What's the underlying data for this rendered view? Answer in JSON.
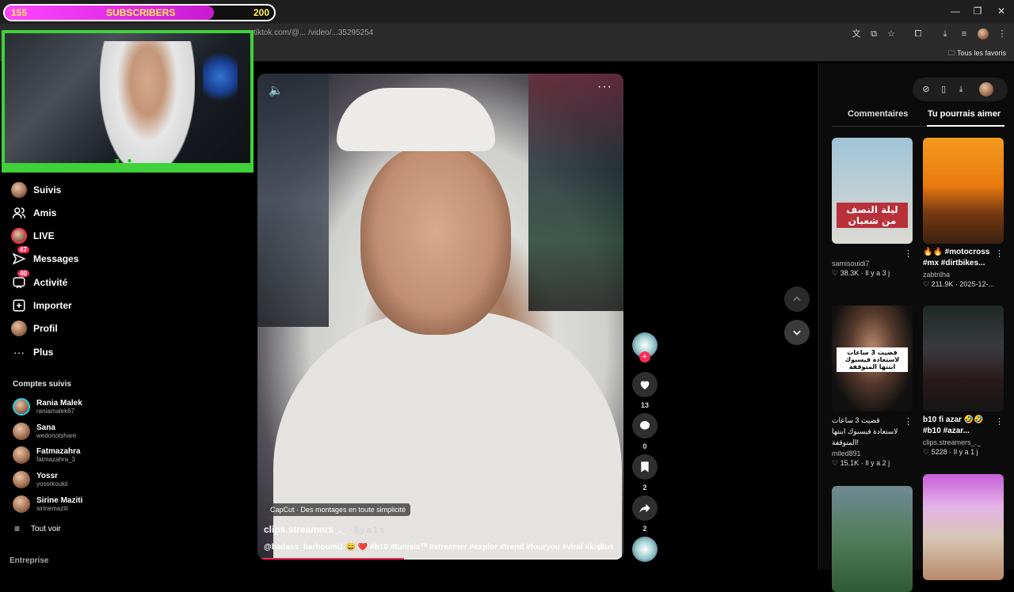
{
  "overlay": {
    "subs_current": "155",
    "subs_label": "SUBSCRIBERS",
    "subs_goal": "200",
    "subs_progress": 0.775,
    "webcam_logo": "bio"
  },
  "browser": {
    "url": "tiktok.com/@... /video/...35295254",
    "bookmarks_label": "Tous les favoris",
    "window_minimize": "—",
    "window_restore": "❐",
    "window_close": "✕"
  },
  "sidebar": {
    "items": [
      {
        "label": "Suivis",
        "icon": "following-avatar-icon"
      },
      {
        "label": "Amis",
        "icon": "friends-icon"
      },
      {
        "label": "LIVE",
        "icon": "live-icon"
      },
      {
        "label": "Messages",
        "icon": "messages-icon",
        "badge": "47"
      },
      {
        "label": "Activité",
        "icon": "activity-icon",
        "badge": "40"
      },
      {
        "label": "Importer",
        "icon": "upload-icon"
      },
      {
        "label": "Profil",
        "icon": "profile-icon"
      },
      {
        "label": "Plus",
        "icon": "more-icon"
      }
    ],
    "following_title": "Comptes suivis",
    "accounts": [
      {
        "name": "Rania Malek",
        "handle": "raniamalek67"
      },
      {
        "name": "Sana",
        "handle": "wedonotshare"
      },
      {
        "name": "Fatmazahra",
        "handle": "fatmazahra_3"
      },
      {
        "name": "Yossr",
        "handle": "yossrkoukii"
      },
      {
        "name": "Sirine Maziti",
        "handle": "sirinemaziti"
      }
    ],
    "see_all": "Tout voir",
    "footer": "Entreprise"
  },
  "video": {
    "capcut": "CapCut · Des montages en toute simplicité",
    "author": "clips.streamers_._",
    "time": "· Il y a 1 s",
    "caption": "@badass_barhoumi1 😄 ❤️ #b10 #tunisiaᵀᴺ #streamer #explor #trend #fouryou #viral #kick ...",
    "more": "plus",
    "progress": 0.4
  },
  "actions": {
    "likes": "13",
    "comments": "0",
    "saves": "2",
    "shares": "2"
  },
  "right_panel": {
    "tabs": [
      "Commentaires",
      "Tu pourrais aimer"
    ],
    "active_tab": "Tu pourrais aimer",
    "cards": [
      {
        "thumb_text": "ليلة النصف من شعبان",
        "title": "",
        "user": "samisouidi7",
        "meta": "♡ 38.3K · Il y a 3 j"
      },
      {
        "thumb_text": "",
        "title": "🔥🔥 #motocross #mx #dirtbikes...",
        "user": "zabtrilha",
        "meta": "♡ 211.9K · 2025-12-..."
      },
      {
        "thumb_text": "قضيت 3 ساعات لاستعادة فيسبوك ابنتها المتوقفة",
        "title": "قضيت 3 ساعات لاستعادة فيسبوك ابنتها المتوقفة!",
        "user": "miled891",
        "meta": "♡ 15.1K · Il y a 2 j"
      },
      {
        "thumb_text": "",
        "title": "b10 fi azar 🤣🤣 #b10 #azar...",
        "user": "clips.streamers_._",
        "meta": "♡ 5228 · Il y a 1 j"
      }
    ]
  }
}
